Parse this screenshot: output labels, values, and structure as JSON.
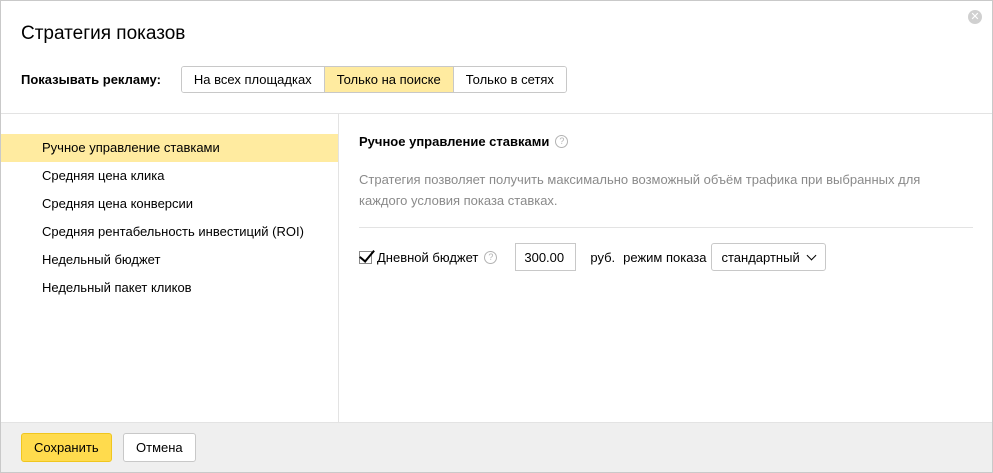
{
  "dialog": {
    "title": "Стратегия показов",
    "close_icon": "close-icon"
  },
  "show": {
    "label": "Показывать рекламу:",
    "options": [
      "На всех площадках",
      "Только на поиске",
      "Только в сетях"
    ],
    "selected": "Только на поиске"
  },
  "sidebar": {
    "items": [
      {
        "label": "Ручное управление ставками",
        "active": true
      },
      {
        "label": "Средняя цена клика",
        "active": false
      },
      {
        "label": "Средняя цена конверсии",
        "active": false
      },
      {
        "label": "Средняя рентабельность инвестиций (ROI)",
        "active": false
      },
      {
        "label": "Недельный бюджет",
        "active": false
      },
      {
        "label": "Недельный пакет кликов",
        "active": false
      }
    ]
  },
  "main": {
    "title": "Ручное управление ставками",
    "help_icon": "?",
    "description": "Стратегия позволяет получить максимально возможный объём трафика при выбранных для каждого условия показа ставках.",
    "budget": {
      "checked": true,
      "label": "Дневной бюджет",
      "help_icon": "?",
      "value": "300.00",
      "currency": "руб.",
      "mode_label": "режим показа",
      "mode_value": "стандартный"
    }
  },
  "footer": {
    "save_label": "Сохранить",
    "cancel_label": "Отмена"
  },
  "colors": {
    "accent_yellow": "#ffeba0",
    "save_button": "#ffdb4d",
    "footer_bg": "#efefef"
  }
}
